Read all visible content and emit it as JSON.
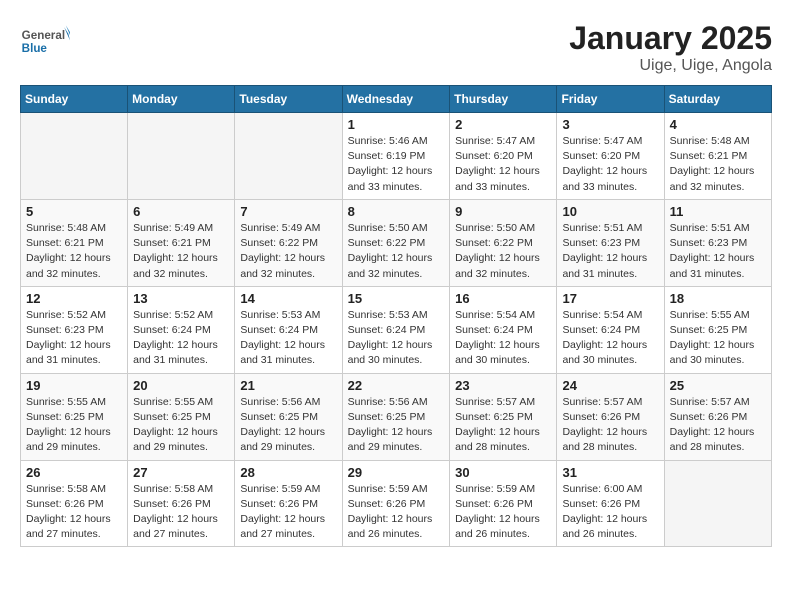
{
  "logo": {
    "general": "General",
    "blue": "Blue"
  },
  "title": "January 2025",
  "subtitle": "Uige, Uige, Angola",
  "days_of_week": [
    "Sunday",
    "Monday",
    "Tuesday",
    "Wednesday",
    "Thursday",
    "Friday",
    "Saturday"
  ],
  "weeks": [
    [
      {
        "day": "",
        "info": ""
      },
      {
        "day": "",
        "info": ""
      },
      {
        "day": "",
        "info": ""
      },
      {
        "day": "1",
        "info": "Sunrise: 5:46 AM\nSunset: 6:19 PM\nDaylight: 12 hours and 33 minutes."
      },
      {
        "day": "2",
        "info": "Sunrise: 5:47 AM\nSunset: 6:20 PM\nDaylight: 12 hours and 33 minutes."
      },
      {
        "day": "3",
        "info": "Sunrise: 5:47 AM\nSunset: 6:20 PM\nDaylight: 12 hours and 33 minutes."
      },
      {
        "day": "4",
        "info": "Sunrise: 5:48 AM\nSunset: 6:21 PM\nDaylight: 12 hours and 32 minutes."
      }
    ],
    [
      {
        "day": "5",
        "info": "Sunrise: 5:48 AM\nSunset: 6:21 PM\nDaylight: 12 hours and 32 minutes."
      },
      {
        "day": "6",
        "info": "Sunrise: 5:49 AM\nSunset: 6:21 PM\nDaylight: 12 hours and 32 minutes."
      },
      {
        "day": "7",
        "info": "Sunrise: 5:49 AM\nSunset: 6:22 PM\nDaylight: 12 hours and 32 minutes."
      },
      {
        "day": "8",
        "info": "Sunrise: 5:50 AM\nSunset: 6:22 PM\nDaylight: 12 hours and 32 minutes."
      },
      {
        "day": "9",
        "info": "Sunrise: 5:50 AM\nSunset: 6:22 PM\nDaylight: 12 hours and 32 minutes."
      },
      {
        "day": "10",
        "info": "Sunrise: 5:51 AM\nSunset: 6:23 PM\nDaylight: 12 hours and 31 minutes."
      },
      {
        "day": "11",
        "info": "Sunrise: 5:51 AM\nSunset: 6:23 PM\nDaylight: 12 hours and 31 minutes."
      }
    ],
    [
      {
        "day": "12",
        "info": "Sunrise: 5:52 AM\nSunset: 6:23 PM\nDaylight: 12 hours and 31 minutes."
      },
      {
        "day": "13",
        "info": "Sunrise: 5:52 AM\nSunset: 6:24 PM\nDaylight: 12 hours and 31 minutes."
      },
      {
        "day": "14",
        "info": "Sunrise: 5:53 AM\nSunset: 6:24 PM\nDaylight: 12 hours and 31 minutes."
      },
      {
        "day": "15",
        "info": "Sunrise: 5:53 AM\nSunset: 6:24 PM\nDaylight: 12 hours and 30 minutes."
      },
      {
        "day": "16",
        "info": "Sunrise: 5:54 AM\nSunset: 6:24 PM\nDaylight: 12 hours and 30 minutes."
      },
      {
        "day": "17",
        "info": "Sunrise: 5:54 AM\nSunset: 6:24 PM\nDaylight: 12 hours and 30 minutes."
      },
      {
        "day": "18",
        "info": "Sunrise: 5:55 AM\nSunset: 6:25 PM\nDaylight: 12 hours and 30 minutes."
      }
    ],
    [
      {
        "day": "19",
        "info": "Sunrise: 5:55 AM\nSunset: 6:25 PM\nDaylight: 12 hours and 29 minutes."
      },
      {
        "day": "20",
        "info": "Sunrise: 5:55 AM\nSunset: 6:25 PM\nDaylight: 12 hours and 29 minutes."
      },
      {
        "day": "21",
        "info": "Sunrise: 5:56 AM\nSunset: 6:25 PM\nDaylight: 12 hours and 29 minutes."
      },
      {
        "day": "22",
        "info": "Sunrise: 5:56 AM\nSunset: 6:25 PM\nDaylight: 12 hours and 29 minutes."
      },
      {
        "day": "23",
        "info": "Sunrise: 5:57 AM\nSunset: 6:25 PM\nDaylight: 12 hours and 28 minutes."
      },
      {
        "day": "24",
        "info": "Sunrise: 5:57 AM\nSunset: 6:26 PM\nDaylight: 12 hours and 28 minutes."
      },
      {
        "day": "25",
        "info": "Sunrise: 5:57 AM\nSunset: 6:26 PM\nDaylight: 12 hours and 28 minutes."
      }
    ],
    [
      {
        "day": "26",
        "info": "Sunrise: 5:58 AM\nSunset: 6:26 PM\nDaylight: 12 hours and 27 minutes."
      },
      {
        "day": "27",
        "info": "Sunrise: 5:58 AM\nSunset: 6:26 PM\nDaylight: 12 hours and 27 minutes."
      },
      {
        "day": "28",
        "info": "Sunrise: 5:59 AM\nSunset: 6:26 PM\nDaylight: 12 hours and 27 minutes."
      },
      {
        "day": "29",
        "info": "Sunrise: 5:59 AM\nSunset: 6:26 PM\nDaylight: 12 hours and 26 minutes."
      },
      {
        "day": "30",
        "info": "Sunrise: 5:59 AM\nSunset: 6:26 PM\nDaylight: 12 hours and 26 minutes."
      },
      {
        "day": "31",
        "info": "Sunrise: 6:00 AM\nSunset: 6:26 PM\nDaylight: 12 hours and 26 minutes."
      },
      {
        "day": "",
        "info": ""
      }
    ]
  ]
}
